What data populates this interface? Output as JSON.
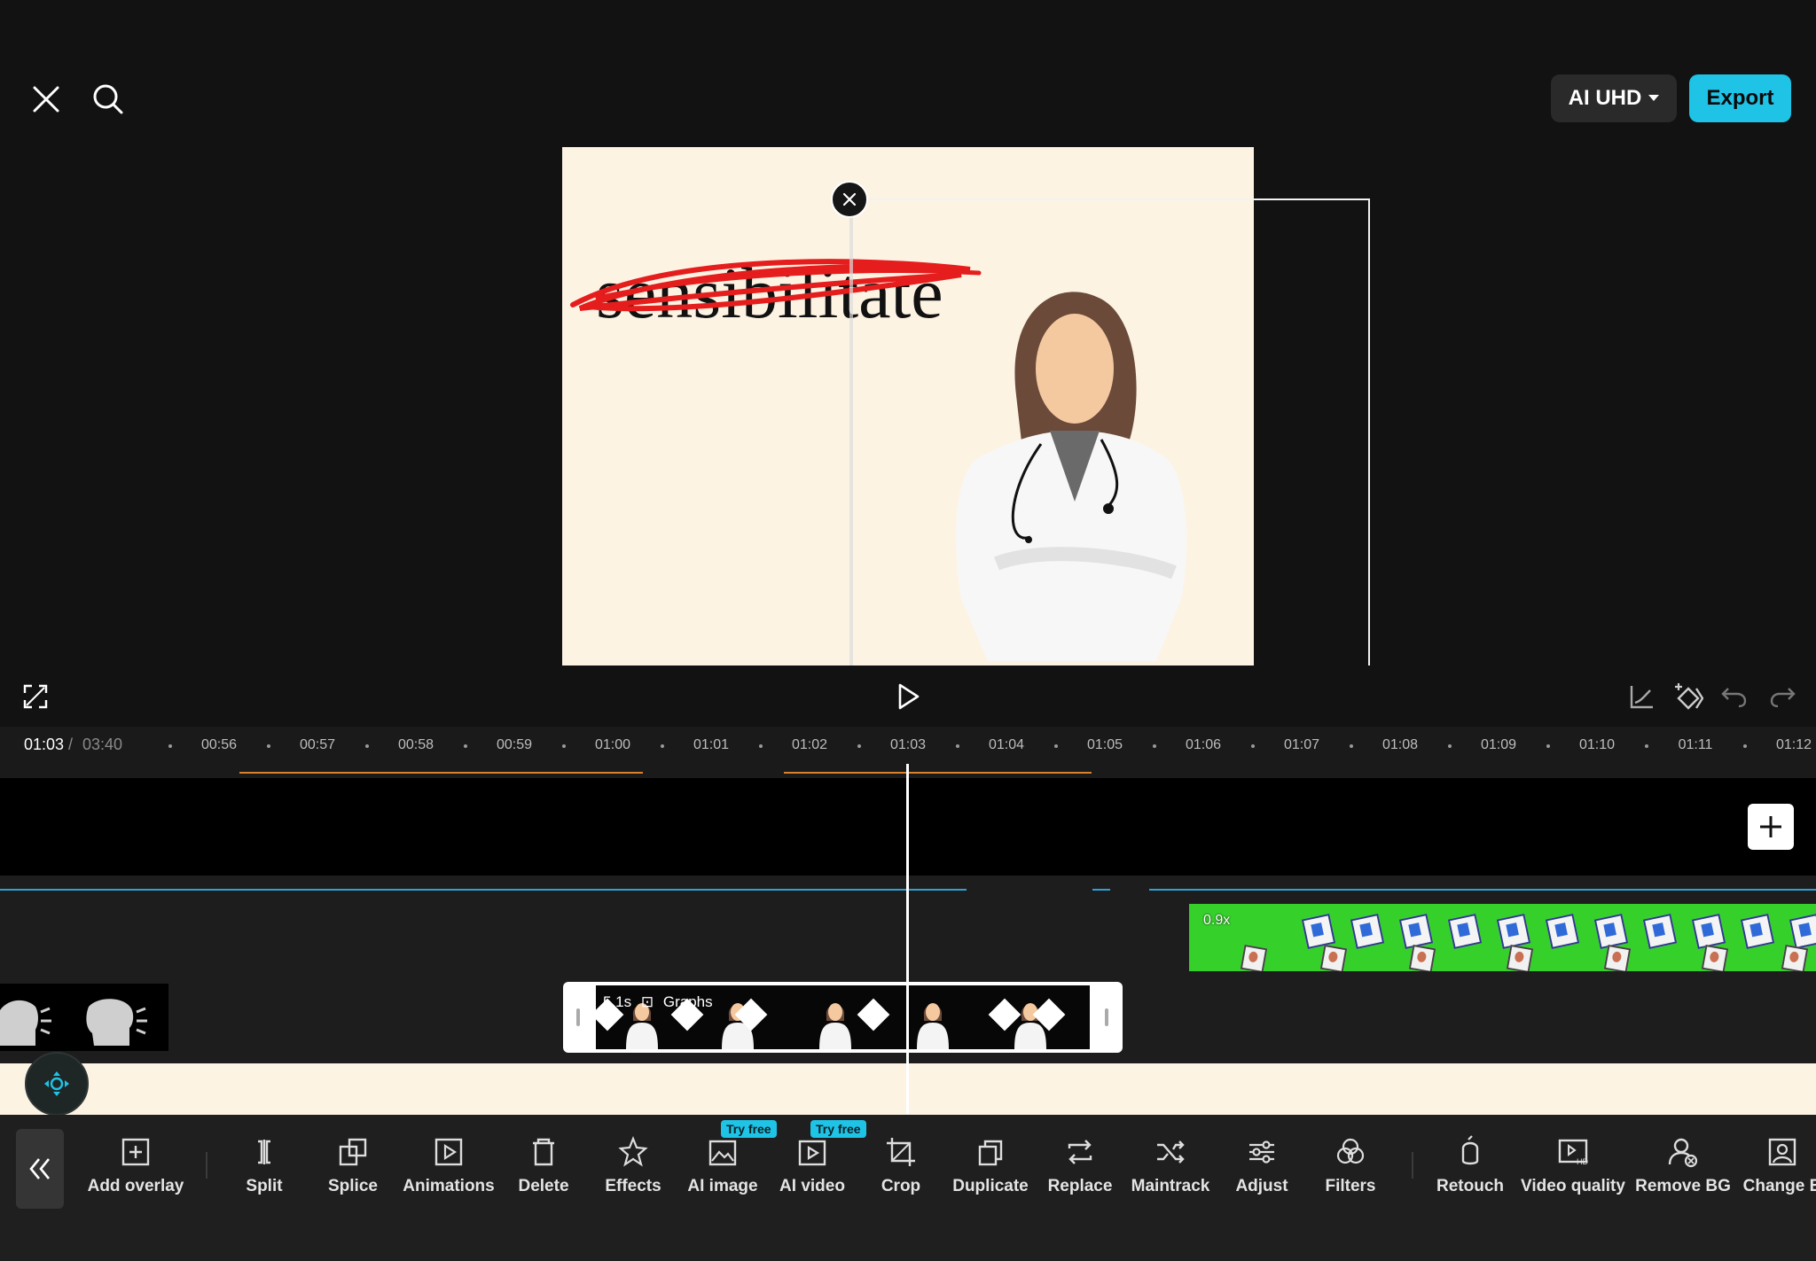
{
  "header": {
    "quality_label": "AI UHD",
    "export_label": "Export"
  },
  "preview": {
    "word": "sensibilitate"
  },
  "timeline": {
    "current_time": "01:03",
    "separator": "/",
    "total_time": "03:40",
    "ticks": [
      "00:56",
      "00:57",
      "00:58",
      "00:59",
      "01:00",
      "01:01",
      "01:02",
      "01:03",
      "01:04",
      "01:05",
      "01:06",
      "01:07",
      "01:08",
      "01:09",
      "01:10",
      "01:11",
      "01:12"
    ],
    "green_clip_label": "0.9x",
    "selected_clip_label": "5.1s",
    "selected_clip_name": "Graphs"
  },
  "toolbar": {
    "tools": [
      {
        "label": "Add overlay",
        "icon": "add-overlay-icon"
      },
      {
        "label": "Split",
        "icon": "split-icon"
      },
      {
        "label": "Splice",
        "icon": "splice-icon"
      },
      {
        "label": "Animations",
        "icon": "animations-icon"
      },
      {
        "label": "Delete",
        "icon": "delete-icon"
      },
      {
        "label": "Effects",
        "icon": "effects-icon"
      },
      {
        "label": "AI image",
        "icon": "ai-image-icon",
        "badge": "Try free"
      },
      {
        "label": "AI video",
        "icon": "ai-video-icon",
        "badge": "Try free"
      },
      {
        "label": "Crop",
        "icon": "crop-icon"
      },
      {
        "label": "Duplicate",
        "icon": "duplicate-icon"
      },
      {
        "label": "Replace",
        "icon": "replace-icon"
      },
      {
        "label": "Maintrack",
        "icon": "maintrack-icon"
      },
      {
        "label": "Adjust",
        "icon": "adjust-icon"
      },
      {
        "label": "Filters",
        "icon": "filters-icon"
      },
      {
        "label": "Retouch",
        "icon": "retouch-icon"
      },
      {
        "label": "Video quality",
        "icon": "video-quality-icon"
      },
      {
        "label": "Remove BG",
        "icon": "remove-bg-icon"
      },
      {
        "label": "Change B",
        "icon": "change-bg-icon"
      }
    ]
  },
  "colors": {
    "accent": "#1fc3e6",
    "background": "#121212",
    "preview_bg": "#fdf3e3",
    "green_screen": "#35d12a"
  }
}
